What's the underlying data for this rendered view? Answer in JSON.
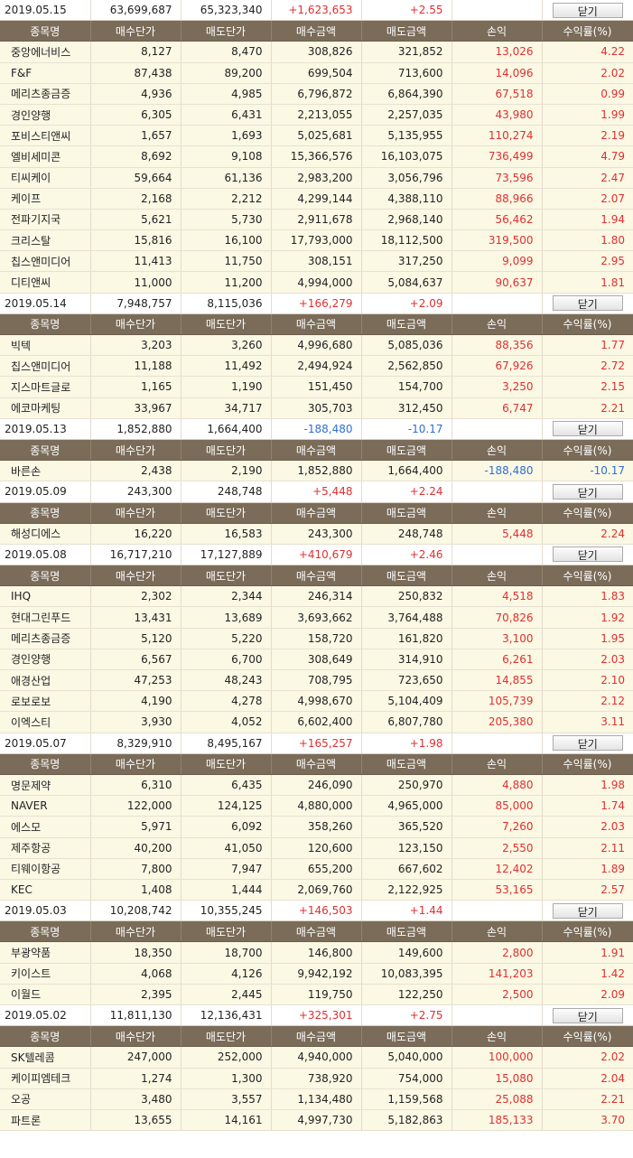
{
  "headers": [
    "종목명",
    "매수단가",
    "매도단가",
    "매수금액",
    "매도금액",
    "손익",
    "수익률(%)"
  ],
  "close_label": "닫기",
  "groups": [
    {
      "date": "2019.05.15",
      "buy_total": "63,699,687",
      "sell_total": "65,323,340",
      "profit": "+1,623,653",
      "rate": "+2.55",
      "sign": "pos",
      "rows": [
        [
          "중앙에너비스",
          "8,127",
          "8,470",
          "308,826",
          "321,852",
          "13,026",
          "4.22"
        ],
        [
          "F&F",
          "87,438",
          "89,200",
          "699,504",
          "713,600",
          "14,096",
          "2.02"
        ],
        [
          "메리츠종금증",
          "4,936",
          "4,985",
          "6,796,872",
          "6,864,390",
          "67,518",
          "0.99"
        ],
        [
          "경인양행",
          "6,305",
          "6,431",
          "2,213,055",
          "2,257,035",
          "43,980",
          "1.99"
        ],
        [
          "포비스티앤씨",
          "1,657",
          "1,693",
          "5,025,681",
          "5,135,955",
          "110,274",
          "2.19"
        ],
        [
          "엘비세미콘",
          "8,692",
          "9,108",
          "15,366,576",
          "16,103,075",
          "736,499",
          "4.79"
        ],
        [
          "티씨케이",
          "59,664",
          "61,136",
          "2,983,200",
          "3,056,796",
          "73,596",
          "2.47"
        ],
        [
          "케이프",
          "2,168",
          "2,212",
          "4,299,144",
          "4,388,110",
          "88,966",
          "2.07"
        ],
        [
          "전파기지국",
          "5,621",
          "5,730",
          "2,911,678",
          "2,968,140",
          "56,462",
          "1.94"
        ],
        [
          "크리스탈",
          "15,816",
          "16,100",
          "17,793,000",
          "18,112,500",
          "319,500",
          "1.80"
        ],
        [
          "칩스앤미디어",
          "11,413",
          "11,750",
          "308,151",
          "317,250",
          "9,099",
          "2.95"
        ],
        [
          "디티앤씨",
          "11,000",
          "11,200",
          "4,994,000",
          "5,084,637",
          "90,637",
          "1.81"
        ]
      ]
    },
    {
      "date": "2019.05.14",
      "buy_total": "7,948,757",
      "sell_total": "8,115,036",
      "profit": "+166,279",
      "rate": "+2.09",
      "sign": "pos",
      "rows": [
        [
          "빅텍",
          "3,203",
          "3,260",
          "4,996,680",
          "5,085,036",
          "88,356",
          "1.77"
        ],
        [
          "칩스앤미디어",
          "11,188",
          "11,492",
          "2,494,924",
          "2,562,850",
          "67,926",
          "2.72"
        ],
        [
          "지스마트글로",
          "1,165",
          "1,190",
          "151,450",
          "154,700",
          "3,250",
          "2.15"
        ],
        [
          "에코마케팅",
          "33,967",
          "34,717",
          "305,703",
          "312,450",
          "6,747",
          "2.21"
        ]
      ]
    },
    {
      "date": "2019.05.13",
      "buy_total": "1,852,880",
      "sell_total": "1,664,400",
      "profit": "-188,480",
      "rate": "-10.17",
      "sign": "neg",
      "rows": [
        [
          "바른손",
          "2,438",
          "2,190",
          "1,852,880",
          "1,664,400",
          "-188,480",
          "-10.17"
        ]
      ]
    },
    {
      "date": "2019.05.09",
      "buy_total": "243,300",
      "sell_total": "248,748",
      "profit": "+5,448",
      "rate": "+2.24",
      "sign": "pos",
      "rows": [
        [
          "해성디에스",
          "16,220",
          "16,583",
          "243,300",
          "248,748",
          "5,448",
          "2.24"
        ]
      ]
    },
    {
      "date": "2019.05.08",
      "buy_total": "16,717,210",
      "sell_total": "17,127,889",
      "profit": "+410,679",
      "rate": "+2.46",
      "sign": "pos",
      "rows": [
        [
          "IHQ",
          "2,302",
          "2,344",
          "246,314",
          "250,832",
          "4,518",
          "1.83"
        ],
        [
          "현대그린푸드",
          "13,431",
          "13,689",
          "3,693,662",
          "3,764,488",
          "70,826",
          "1.92"
        ],
        [
          "메리츠종금증",
          "5,120",
          "5,220",
          "158,720",
          "161,820",
          "3,100",
          "1.95"
        ],
        [
          "경인양행",
          "6,567",
          "6,700",
          "308,649",
          "314,910",
          "6,261",
          "2.03"
        ],
        [
          "애경산업",
          "47,253",
          "48,243",
          "708,795",
          "723,650",
          "14,855",
          "2.10"
        ],
        [
          "로보로보",
          "4,190",
          "4,278",
          "4,998,670",
          "5,104,409",
          "105,739",
          "2.12"
        ],
        [
          "이엑스티",
          "3,930",
          "4,052",
          "6,602,400",
          "6,807,780",
          "205,380",
          "3.11"
        ]
      ]
    },
    {
      "date": "2019.05.07",
      "buy_total": "8,329,910",
      "sell_total": "8,495,167",
      "profit": "+165,257",
      "rate": "+1.98",
      "sign": "pos",
      "rows": [
        [
          "명문제약",
          "6,310",
          "6,435",
          "246,090",
          "250,970",
          "4,880",
          "1.98"
        ],
        [
          "NAVER",
          "122,000",
          "124,125",
          "4,880,000",
          "4,965,000",
          "85,000",
          "1.74"
        ],
        [
          "에스모",
          "5,971",
          "6,092",
          "358,260",
          "365,520",
          "7,260",
          "2.03"
        ],
        [
          "제주항공",
          "40,200",
          "41,050",
          "120,600",
          "123,150",
          "2,550",
          "2.11"
        ],
        [
          "티웨이항공",
          "7,800",
          "7,947",
          "655,200",
          "667,602",
          "12,402",
          "1.89"
        ],
        [
          "KEC",
          "1,408",
          "1,444",
          "2,069,760",
          "2,122,925",
          "53,165",
          "2.57"
        ]
      ]
    },
    {
      "date": "2019.05.03",
      "buy_total": "10,208,742",
      "sell_total": "10,355,245",
      "profit": "+146,503",
      "rate": "+1.44",
      "sign": "pos",
      "rows": [
        [
          "부광약품",
          "18,350",
          "18,700",
          "146,800",
          "149,600",
          "2,800",
          "1.91"
        ],
        [
          "키이스트",
          "4,068",
          "4,126",
          "9,942,192",
          "10,083,395",
          "141,203",
          "1.42"
        ],
        [
          "이월드",
          "2,395",
          "2,445",
          "119,750",
          "122,250",
          "2,500",
          "2.09"
        ]
      ]
    },
    {
      "date": "2019.05.02",
      "buy_total": "11,811,130",
      "sell_total": "12,136,431",
      "profit": "+325,301",
      "rate": "+2.75",
      "sign": "pos",
      "rows": [
        [
          "SK텔레콤",
          "247,000",
          "252,000",
          "4,940,000",
          "5,040,000",
          "100,000",
          "2.02"
        ],
        [
          "케이피엠테크",
          "1,274",
          "1,300",
          "738,920",
          "754,000",
          "15,080",
          "2.04"
        ],
        [
          "오공",
          "3,480",
          "3,557",
          "1,134,480",
          "1,159,568",
          "25,088",
          "2.21"
        ],
        [
          "파트론",
          "13,655",
          "14,161",
          "4,997,730",
          "5,182,863",
          "185,133",
          "3.70"
        ]
      ]
    }
  ]
}
